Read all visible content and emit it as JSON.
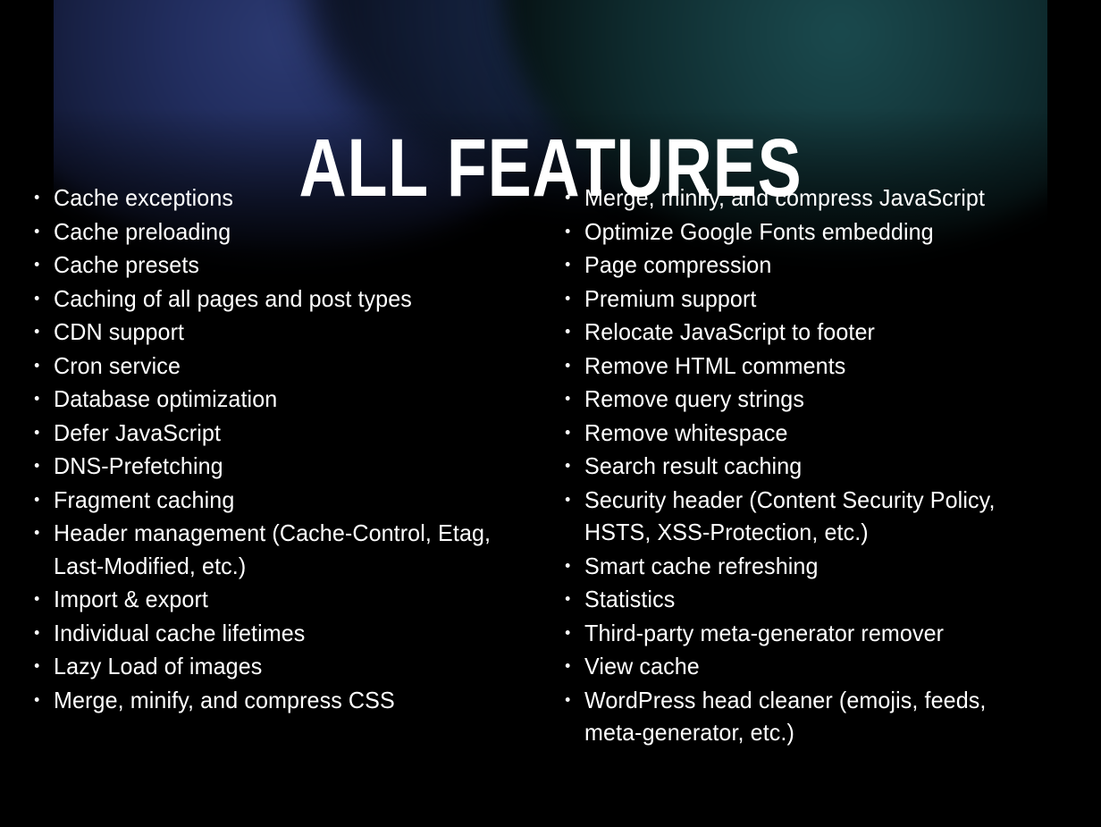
{
  "slide": {
    "title": "ALL FEATURES",
    "background_color": "#000000",
    "text_color": "#ffffff",
    "glow_blue": "#232f61",
    "glow_teal": "#153b3f",
    "bullet_glyph": "•"
  },
  "columns": {
    "left": [
      "Cache exceptions",
      "Cache preloading",
      "Cache presets",
      "Caching of all pages and post types",
      "CDN support",
      "Cron service",
      "Database optimization",
      "Defer JavaScript",
      "DNS-Prefetching",
      "Fragment caching",
      "Header management (Cache-Control, Etag, Last-Modified, etc.)",
      "Import & export",
      "Individual cache lifetimes",
      "Lazy Load of images",
      "Merge, minify, and compress CSS"
    ],
    "right": [
      "Merge, minify, and compress JavaScript",
      "Optimize Google Fonts embedding",
      "Page compression",
      "Premium support",
      "Relocate JavaScript to footer",
      "Remove HTML comments",
      "Remove query strings",
      "Remove whitespace",
      "Search result caching",
      "Security header (Content Security Policy, HSTS, XSS-Protection, etc.)",
      "Smart cache refreshing",
      "Statistics",
      "Third-party meta-generator remover",
      "View cache",
      "WordPress head cleaner (emojis, feeds, meta-generator, etc.)"
    ]
  }
}
